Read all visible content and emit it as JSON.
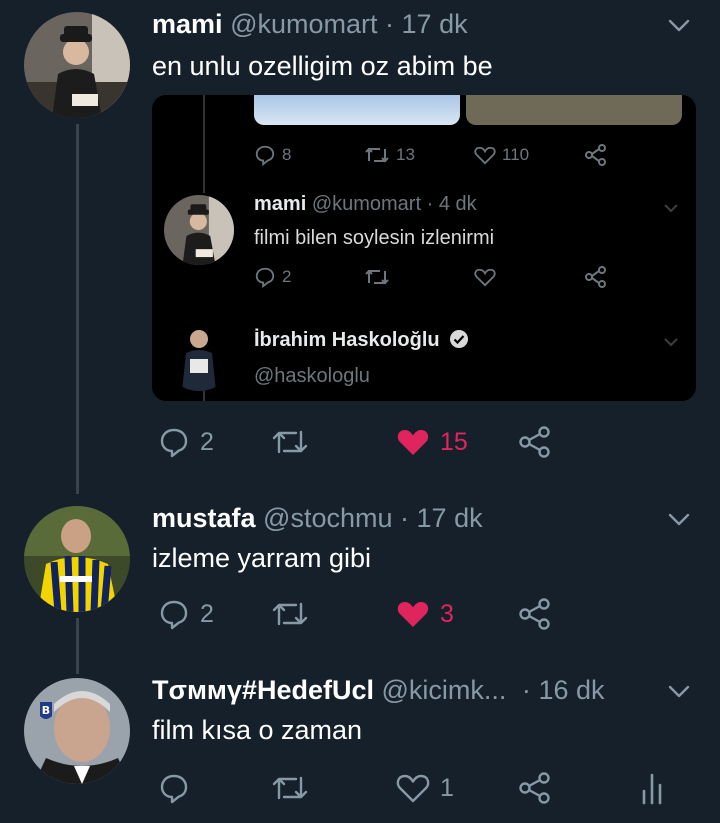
{
  "colors": {
    "background": "#15202b",
    "muted": "#8899a6",
    "like": "#e0245e",
    "thread_line": "#38444d"
  },
  "tweets": [
    {
      "name": "mami",
      "handle": "@kumomart",
      "separator": "·",
      "time": "17 dk",
      "text": "en unlu ozelligim oz abim be",
      "replies": "2",
      "retweets": "",
      "likes": "15",
      "liked": true,
      "embedded_screenshot": {
        "top_actions": {
          "replies": "8",
          "retweets": "13",
          "likes": "110"
        },
        "reply": {
          "name": "mami",
          "handle": "@kumomart",
          "separator": "·",
          "time": "4 dk",
          "text": "filmi bilen soylesin izlenirmi",
          "replies": "2"
        },
        "quoted": {
          "name": "İbrahim Haskoloğlu",
          "handle": "@haskologlu",
          "verified": true
        }
      }
    },
    {
      "name": "mustafa",
      "handle": "@stochmu",
      "separator": "·",
      "time": "17 dk",
      "text": "izleme yarram gibi",
      "replies": "2",
      "retweets": "",
      "likes": "3",
      "liked": true
    },
    {
      "name": "Tσммγ#HedefUcl",
      "handle": "@kicimk...",
      "separator": "·",
      "time": "16 dk",
      "text": "film kısa o zaman",
      "replies": "",
      "retweets": "",
      "likes": "1",
      "liked": false
    }
  ]
}
